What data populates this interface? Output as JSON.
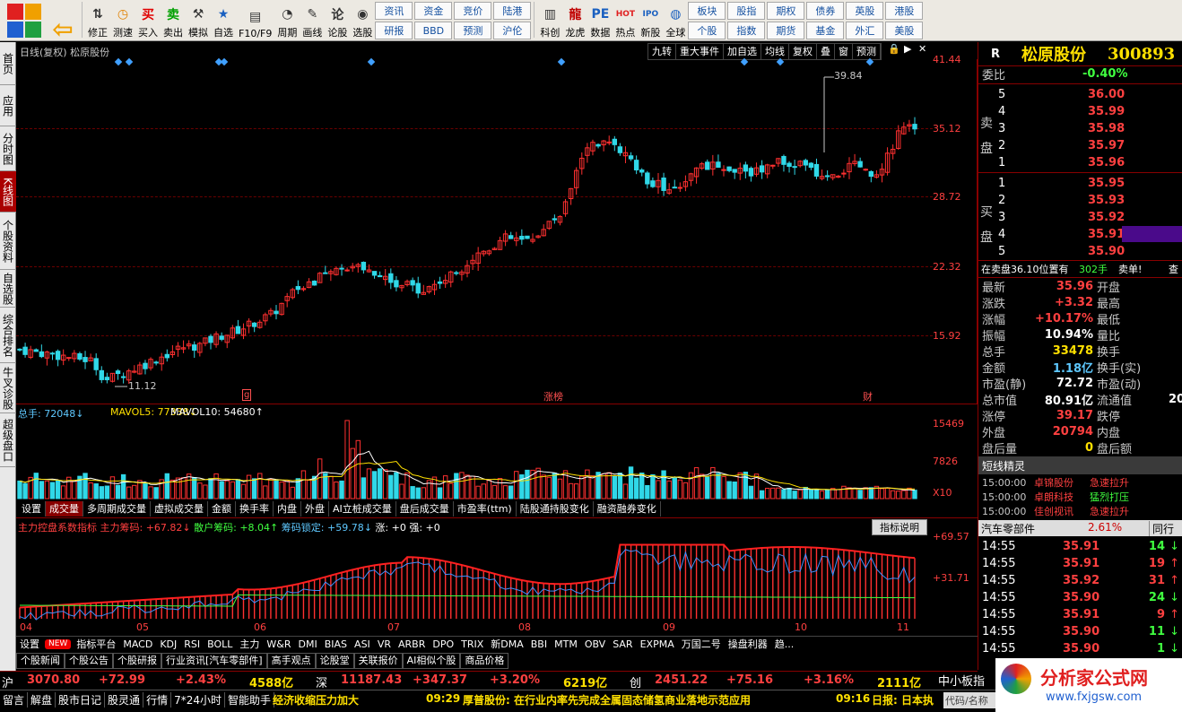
{
  "toolbar": {
    "buttons": [
      {
        "label": "修正",
        "icon": "arrow-up-down-icon"
      },
      {
        "label": "测速",
        "icon": "clock-icon"
      },
      {
        "label": "买入",
        "icon": "buy-icon",
        "glyph": "买"
      },
      {
        "label": "卖出",
        "icon": "sell-icon",
        "glyph": "卖"
      },
      {
        "label": "模拟",
        "icon": "hammer-icon"
      },
      {
        "label": "自选",
        "icon": "star-icon"
      },
      {
        "label": "F10/F9",
        "icon": "f10-icon"
      },
      {
        "label": "周期",
        "icon": "period-icon"
      },
      {
        "label": "画线",
        "icon": "pen-icon"
      },
      {
        "label": "论股",
        "icon": "forum-icon"
      },
      {
        "label": "选股",
        "icon": "stock-pick-icon"
      }
    ],
    "grid_a": [
      "资讯",
      "研报",
      "资金",
      "BBD",
      "竞价",
      "预测",
      "陆港",
      "沪伦"
    ],
    "buttons2": [
      {
        "label": "科创",
        "icon": "kechuang-icon"
      },
      {
        "label": "龙虎",
        "icon": "dragon-tiger-icon"
      },
      {
        "label": "数据",
        "icon": "data-icon",
        "glyph": "PE"
      },
      {
        "label": "热点",
        "icon": "hot-icon",
        "glyph": "HOT"
      },
      {
        "label": "新股",
        "icon": "new-stock-icon",
        "glyph": "IPO"
      },
      {
        "label": "全球",
        "icon": "globe-icon"
      }
    ],
    "grid_b": [
      "板块",
      "个股",
      "股指",
      "指数",
      "期权",
      "期货",
      "债券",
      "基金",
      "英股",
      "外汇",
      "港股",
      "美股"
    ]
  },
  "sidetabs": [
    "首页",
    "应用",
    "分时图",
    "K线图",
    "个股资料",
    "自选股",
    "综合排名",
    "牛叉诊股",
    "超级盘口"
  ],
  "chart_header": {
    "title": "日线(复权) 松原股份",
    "buttons": [
      "九转",
      "重大事件",
      "加自选",
      "均线",
      "复权",
      "叠",
      "窗",
      "预测"
    ]
  },
  "kline": {
    "axis_labels": [
      "41.44",
      "35.12",
      "28.72",
      "22.32",
      "15.92"
    ],
    "max_label": "39.84",
    "min_label": "11.12",
    "markers": [
      "g",
      "涨榜",
      "财"
    ],
    "ymin": 11.0,
    "ymax": 41.44
  },
  "volume": {
    "legend": {
      "total": "总手: 72048↓",
      "ma5": "MAVOL5: 77338↓",
      "ma10": "MAVOL10: 54680↑"
    },
    "axis_labels": [
      "15469",
      "7826"
    ],
    "unit": "X10",
    "max": 15469
  },
  "indicator_tabs": [
    "设置",
    "成交量",
    "多周期成交量",
    "虚拟成交量",
    "金额",
    "换手率",
    "内盘",
    "外盘",
    "AI立桩成交量",
    "盘后成交量",
    "市盈率(ttm)",
    "陆股通持股变化",
    "融资融券变化"
  ],
  "chip": {
    "legend": {
      "name": "主力控盘系数指标",
      "main": "主力筹码: +67.82↓",
      "retail": "散户筹码: +8.04↑",
      "locked": "筹码锁定: +59.78↓",
      "rise": "涨: +0 强: +0"
    },
    "button": "指标说明",
    "axis_labels": [
      "+69.57",
      "+31.71"
    ]
  },
  "months": [
    "04",
    "05",
    "06",
    "07",
    "08",
    "09",
    "10",
    "11"
  ],
  "bottom_tabs": [
    "设置",
    "NEW",
    "指标平台",
    "MACD",
    "KDJ",
    "RSI",
    "BOLL",
    "主力",
    "W&R",
    "DMI",
    "BIAS",
    "ASI",
    "VR",
    "ARBR",
    "DPO",
    "TRIX",
    "新DMA",
    "BBI",
    "MTM",
    "OBV",
    "SAR",
    "EXPMA",
    "万国二号",
    "操盘利器",
    "趋..."
  ],
  "news_tabs": [
    "个股新闻",
    "个股公告",
    "个股研报",
    "行业资讯[汽车零部件]",
    "高手观点",
    "论股堂",
    "关联报价",
    "AI相似个股",
    "商品价格"
  ],
  "stock": {
    "flag": "R",
    "name": "松原股份",
    "code": "300893",
    "weibi_label": "委比",
    "weibi": "-0.40%",
    "sell_label": "卖盘",
    "buy_label": "买盘",
    "asks": [
      {
        "lv": "5",
        "p": "36.00"
      },
      {
        "lv": "4",
        "p": "35.99"
      },
      {
        "lv": "3",
        "p": "35.98"
      },
      {
        "lv": "2",
        "p": "35.97"
      },
      {
        "lv": "1",
        "p": "35.96"
      }
    ],
    "bids": [
      {
        "lv": "1",
        "p": "35.95"
      },
      {
        "lv": "2",
        "p": "35.93"
      },
      {
        "lv": "3",
        "p": "35.92"
      },
      {
        "lv": "4",
        "p": "35.91"
      },
      {
        "lv": "5",
        "p": "35.90"
      }
    ],
    "notice": "在卖盘36.10位置有",
    "notice_qty": "302手",
    "notice_tag": "卖单!",
    "notice_more": "查",
    "stats": [
      {
        "k": "最新",
        "v": "35.96",
        "k2": "开盘"
      },
      {
        "k": "涨跌",
        "v": "+3.32",
        "k2": "最高"
      },
      {
        "k": "涨幅",
        "v": "+10.17%",
        "k2": "最低"
      },
      {
        "k": "振幅",
        "v": "10.94%",
        "k2": "量比"
      },
      {
        "k": "总手",
        "v": "33478",
        "k2": "换手"
      },
      {
        "k": "金额",
        "v": "1.18亿",
        "k2": "换手(实)"
      },
      {
        "k": "市盈(静)",
        "v": "72.72",
        "k2": "市盈(动)"
      },
      {
        "k": "总市值",
        "v": "80.91亿",
        "k2": "流通值"
      },
      {
        "k": "涨停",
        "v": "39.17",
        "k2": "跌停"
      },
      {
        "k": "外盘",
        "v": "20794",
        "k2": "内盘"
      },
      {
        "k": "盘后量",
        "v": "0",
        "k2": "盘后额"
      }
    ],
    "liutong_partial": "20"
  },
  "shortline": {
    "title": "短线精灵",
    "items": [
      {
        "t": "15:00:00",
        "name": "卓锦股份",
        "ev": "急速拉升"
      },
      {
        "t": "15:00:00",
        "name": "卓朗科技",
        "ev": "猛烈打压"
      },
      {
        "t": "15:00:00",
        "name": "佳创视讯",
        "ev": "急速拉升"
      }
    ]
  },
  "sector": {
    "name": "汽车零部件",
    "pct": "2.61%",
    "more": "同行"
  },
  "ticks": [
    {
      "t": "14:55",
      "p": "35.91",
      "v": "14",
      "d": "down"
    },
    {
      "t": "14:55",
      "p": "35.91",
      "v": "19",
      "d": "up"
    },
    {
      "t": "14:55",
      "p": "35.92",
      "v": "31",
      "d": "up"
    },
    {
      "t": "14:55",
      "p": "35.90",
      "v": "24",
      "d": "down"
    },
    {
      "t": "14:55",
      "p": "35.91",
      "v": "9",
      "d": "up"
    },
    {
      "t": "14:55",
      "p": "35.90",
      "v": "11",
      "d": "down"
    },
    {
      "t": "14:55",
      "p": "35.90",
      "v": "1",
      "d": "down"
    }
  ],
  "indexes": [
    {
      "n": "沪",
      "v": "3070.80",
      "c": "+72.99",
      "p": "+2.43%",
      "a": "4588亿"
    },
    {
      "n": "深",
      "v": "11187.43",
      "c": "+347.37",
      "p": "+3.20%",
      "a": "6219亿"
    },
    {
      "n": "创",
      "v": "2451.22",
      "c": "+75.16",
      "p": "+3.16%",
      "a": "2111亿"
    }
  ],
  "index_more": "中小板指",
  "statusbar": {
    "items": [
      "留言",
      "解盘",
      "股市日记",
      "股灵通",
      "行情",
      "7*24小时",
      "智能助手"
    ],
    "headline": "经济收缩压力加大",
    "news1_time": "09:29",
    "news1": "厚普股份: 在行业内率先完成全属固态储氢商业落地示范应用",
    "news2_time": "09:16",
    "news2": "日报: 日本执",
    "input": "代码/名称"
  },
  "watermark": {
    "title": "分析家公式网",
    "url": "www.fxjgsw.com"
  }
}
